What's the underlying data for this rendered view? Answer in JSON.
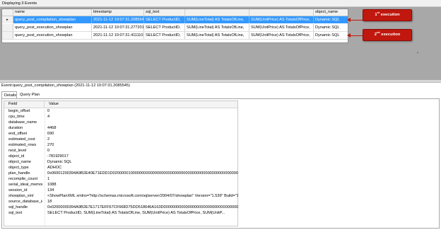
{
  "header": {
    "title": "Displaying 3 Events"
  },
  "grid": {
    "columns": [
      "name",
      "timestamp",
      "sql_text",
      "",
      "",
      "object_name"
    ],
    "rows": [
      {
        "selector": "▸",
        "name": "query_post_compilation_showplan",
        "timestamp": "2021-11-12 10:07:31.2085545",
        "sql_text": "SELECT ProductID,",
        "c4": "SUM(LineTotal) AS TotalsOfLine,",
        "c5": "SUM(UnitPrice) AS TotalsOfPrice,",
        "object_name": "Dynamic SQL",
        "selected": true
      },
      {
        "selector": "",
        "name": "query_post_execution_showplan",
        "timestamp": "2021-11-12 10:07:31.2772010",
        "sql_text": "SELECT ProductID,",
        "c4": "SUM(LineTotal) AS TotalsOfLine,",
        "c5": "SUM(UnitPrice) AS TotalsOfPrice,",
        "object_name": "Dynamic SQL",
        "selected": false
      },
      {
        "selector": "",
        "name": "query_post_execution_showplan",
        "timestamp": "2021-11-12 10:07:31.4111102",
        "sql_text": "SELECT ProductID,",
        "c4": "SUM(LineTotal) AS TotalsOfLine,",
        "c5": "SUM(UnitPrice) AS TotalsOfPrice,",
        "object_name": "Dynamic SQL",
        "selected": false
      }
    ]
  },
  "callouts": [
    {
      "ordinal": "1",
      "suffix": "st",
      "text": "execution"
    },
    {
      "ordinal": "2",
      "suffix": "nd",
      "text": "execution"
    }
  ],
  "event": {
    "title": "Event:query_post_compilation_showplan (2021-11-12 10:07:31.2085545)"
  },
  "tabs": [
    "Details",
    "Query Plan"
  ],
  "details": {
    "headers": [
      "Field",
      "Value"
    ],
    "rows": [
      {
        "field": "begin_offset",
        "value": "0"
      },
      {
        "field": "cpu_time",
        "value": "4"
      },
      {
        "field": "database_name",
        "value": ""
      },
      {
        "field": "duration",
        "value": "4468"
      },
      {
        "field": "end_offset",
        "value": "690"
      },
      {
        "field": "estimated_cost",
        "value": "2"
      },
      {
        "field": "estimated_rows",
        "value": "270"
      },
      {
        "field": "nest_level",
        "value": "0"
      },
      {
        "field": "object_id",
        "value": "-781929017"
      },
      {
        "field": "object_name",
        "value": "Dynamic SQL"
      },
      {
        "field": "object_type",
        "value": "ADHOC"
      },
      {
        "field": "plan_handle",
        "value": "0x06001200394A9B2E40E71EDD1D020000010000000000000000000000000000000000000000000000000000000000"
      },
      {
        "field": "recompile_count",
        "value": "1"
      },
      {
        "field": "serial_ideal_memor...",
        "value": "1088"
      },
      {
        "field": "session_id",
        "value": "134"
      },
      {
        "field": "showplan_xml",
        "value": "<ShowPlanXML xmlns=\"http://schemas.microsoft.com/sqlserver/2004/07/showplan\" Version=\"1.539\" Build=\"15.0.4..."
      },
      {
        "field": "source_database_id",
        "value": "18"
      },
      {
        "field": "sql_handle",
        "value": "0x02000000394A9B2E7E1717EFF67CF668D75DD518646A163D0000000000000000000000000000000000000000"
      },
      {
        "field": "sql_text",
        "value": "SELECT ProductID,          SUM(LineTotal) AS TotalsOfLine,          SUM(UnitPrice) AS TotalsOfPrice,          SUM(UnitP..."
      }
    ]
  },
  "colors": {
    "selection": "#3399ff",
    "callout": "#c0170e",
    "top_background": "#a8a8a8"
  }
}
